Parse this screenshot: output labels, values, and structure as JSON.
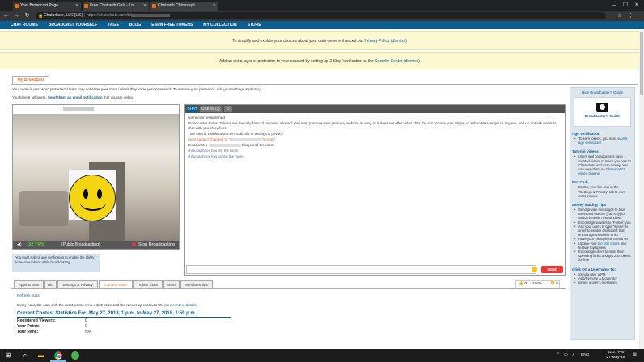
{
  "browser": {
    "tabs": [
      {
        "title": "Your Broadcast Page",
        "active": true
      },
      {
        "title": "Free Chat with Girls - Liv"
      },
      {
        "title": "Chat with Chloesapli"
      }
    ],
    "url_site": "Chaturbate, LLC [US]",
    "url_prefix": "https://chaturbate.com/b/"
  },
  "nav": {
    "items": [
      "CHAT ROOMS",
      "BROADCAST YOURSELF",
      "TAGS",
      "BLOG",
      "EARN FREE TOKENS",
      "MY COLLECTION",
      "STORE"
    ]
  },
  "notices": {
    "privacy_text": "To simplify and explain your choices about your data we've enhanced our",
    "privacy_link": "Privacy Policy",
    "privacy_dismiss": "(dismiss)",
    "security_text": "Add an extra layer of protection to your account by setting up 2-Step Verification at the",
    "security_link": "Security Center",
    "security_dismiss": "(dismiss)"
  },
  "page": {
    "tab_label": "My Broadcast",
    "password_note": "Your room is password protected. Users may not enter your room unless they know your password. To remove your password, edit your settings & privacy.",
    "followers_prefix": "You have 6 followers.",
    "followers_link": "Send them an email notification",
    "followers_suffix": "that you are online."
  },
  "video": {
    "room_suffix": "'s room",
    "fps": "32 FPS",
    "status": "(Public Broadcasting)",
    "stop_label": "Stop Broadcasting",
    "age_note": "You must submit age verification to enable the ability to receive tokens while broadcasting."
  },
  "chat": {
    "tabs": [
      "CHAT",
      "USERS (2)",
      "☺"
    ],
    "lines": {
      "l1": "connection established",
      "l2": "Broadcaster Rules: Tokens are the only form of payment allowed. You may promote your personal website as long as it does not offer video chat. Do not provide your Skype or Yahoo Messenger to anyone, and do not ask users to chat with you elsewhere.",
      "l3": "Your cam is visible to women. Edit this in settings & privacy.",
      "l4_prefix": "room subject changed to \"",
      "l4_suffix": "'s room\"",
      "l5_prefix": "Broadcaster",
      "l5_suffix": "has joined the room.",
      "l6": "chloesaphirox has left the room.",
      "l7": "chloesaphirox has joined the room."
    },
    "send_label": "SEND"
  },
  "bottom_tabs": [
    "Apps & Bots",
    "Bio",
    "Settings & Privacy",
    "Contest Stats",
    "Token Stats",
    "Share",
    "Memberships"
  ],
  "rating": {
    "up": "0",
    "pct": "100%",
    "down": "0"
  },
  "contest": {
    "refresh": "Refresh Stats",
    "description": "Every hour, the cam with the most points wins a $10 prize and the runner up receives $5.",
    "details_link": "(see contest details)",
    "heading": "Current Contest Statistics For: May 27, 2018, 1 p.m. to May 27, 2018, 1:59 p.m.",
    "rows": [
      {
        "label": "Registered Viewers:",
        "value": "0"
      },
      {
        "label": "Your Points:",
        "value": "0"
      },
      {
        "label": "Your Rank:",
        "value": "N/A"
      }
    ]
  },
  "sidebar": {
    "hide_link": "Hide Broadcaster's Guide",
    "guide_label": "Broadcaster's Guide",
    "age_head": "Age Verification",
    "age_item_prefix": "To earn tokens, you must",
    "age_item_link": "submit age verification",
    "tutorial_head": "Tutorial Videos",
    "tutorial_item_prefix": "Users and broadcasters have created videos to teach you how to Chaturbate and earn money. You can view them on",
    "tutorial_item_link": "Chaturbate's vimeo channel",
    "fanclub_head": "Fan Club",
    "fanclub_item": "Enable your fan club in the \"Settings & Privacy\" tab to earn extra income",
    "money_head": "Money Making Tips",
    "tip1": "Send private messages to blue users and use the [Tab Key] to switch between PM windows",
    "tip2": "Encourage viewers to \"Follow\" you",
    "tip3": "Ask your users to type \"/tipme\" in order to enable emoticons that encourage members to tip",
    "tip4": "Have your microphone turned on",
    "tip5_prefix": "Update your",
    "tip5_link": "bio with colors",
    "tip5_suffix": "and feature top tippers",
    "tip6": "Encourage users to raise their spending limits and get 200 tokens for free",
    "click_head": "Click On a Username To:",
    "click1": "Send a user a PM",
    "click2": "Add/Remove a Moderator",
    "click3": "Ignore a user's messages"
  },
  "taskbar": {
    "lang": "ENG",
    "time": "11:27 PM",
    "date": "27-May-18"
  }
}
